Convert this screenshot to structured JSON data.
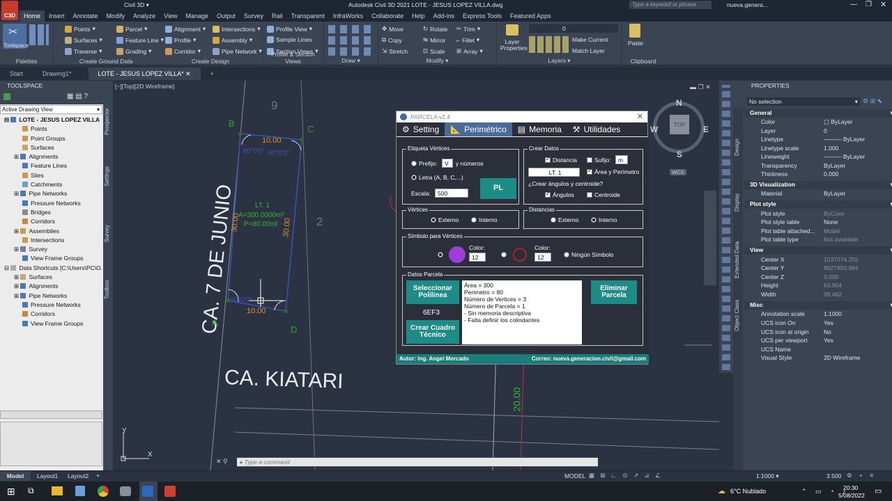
{
  "app": {
    "title": "Autodesk Civil 3D 2021  LOTE - JESUS LOPEZ VILLA.dwg",
    "workspace": "Civil 3D",
    "search_placeholder": "Type a keyword or phrase",
    "user": "nueva.genera...",
    "logo": "C3D"
  },
  "menu_tabs": [
    "Home",
    "Insert",
    "Annotate",
    "Modify",
    "Analyze",
    "View",
    "Manage",
    "Output",
    "Survey",
    "Rail",
    "Transparent",
    "InfraWorks",
    "Collaborate",
    "Help",
    "Add-ins",
    "Express Tools",
    "Featured Apps"
  ],
  "ribbon": {
    "toolspace": "Toolspace",
    "palettes": "Palettes",
    "ground": {
      "items": [
        "Points",
        "Surfaces",
        "Traverse",
        "Parcel",
        "Feature Line",
        "Grading"
      ],
      "title": "Create Ground Data"
    },
    "design": {
      "items": [
        "Alignment",
        "Profile",
        "Corridor",
        "Intersections",
        "Assembly",
        "Pipe Network"
      ],
      "title": "Create Design"
    },
    "profile": {
      "items": [
        "Profile View",
        "Sample Lines",
        "Section Views"
      ],
      "title": "Profile & Section Views"
    },
    "draw": {
      "title": "Draw"
    },
    "modify": {
      "items": [
        "Move",
        "Rotate",
        "Trim",
        "Copy",
        "Mirror",
        "Fillet",
        "Stretch",
        "Scale",
        "Array"
      ],
      "title": "Modify"
    },
    "layers": {
      "layer_properties": "Layer Properties",
      "layer_value": "0",
      "make_current": "Make Current",
      "match_layer": "Match Layer",
      "title": "Layers"
    },
    "clipboard": {
      "paste": "Paste",
      "title": "Clipboard"
    }
  },
  "doc_tabs": [
    "Start",
    "Drawing1*",
    "LOTE - JESUS LOPEZ VILLA*"
  ],
  "toolspace": {
    "title": "TOOLSPACE",
    "view": "Active Drawing View",
    "tree": [
      "LOTE - JESUS LOPEZ VILLA",
      "Points",
      "Point Groups",
      "Surfaces",
      "Alignments",
      "Feature Lines",
      "Sites",
      "Catchments",
      "Pipe Networks",
      "Pressure Networks",
      "Bridges",
      "Corridors",
      "Assemblies",
      "Intersections",
      "Survey",
      "View Frame Groups",
      "Data Shortcuts [C:\\Users\\PC\\O...",
      "Surfaces",
      "Alignments",
      "Pipe Networks",
      "Pressure Networks",
      "Corridors",
      "View Frame Groups"
    ],
    "side_tabs": [
      "Prospector",
      "Settings",
      "Survey",
      "Toolbox"
    ]
  },
  "viewport": {
    "label": "[−][Top][2D Wireframe]",
    "street1": "CA. 7 DE JUNIO",
    "street2": "CA. KIATARI",
    "lot_num": "9",
    "lot_num2": "2",
    "pts": [
      "A",
      "B",
      "C",
      "D"
    ],
    "dims": [
      "10.00",
      "10.00",
      "30.00",
      "30.00",
      "20.00"
    ],
    "angle": "90°0'0\"",
    "lot_label": "LT. 1",
    "area": "A=300.0000m²",
    "perim": "P=80.00ml",
    "compass": {
      "n": "N",
      "s": "S",
      "e": "E",
      "w": "W",
      "top": "TOP",
      "wcs": "WCS"
    },
    "command_placeholder": "Type a command"
  },
  "dialog": {
    "title": "PARCELA v2.4",
    "tabs": [
      "Setting",
      "Perimétrico",
      "Memoria",
      "Utilidades"
    ],
    "etiqueta": {
      "title": "Etiqueta Vértices",
      "prefijo": "Prefijo:",
      "prefijo_val": "V",
      "y_numeros": "y números",
      "letra": "Letra (A, B, C,...)",
      "escala": "Escala:",
      "escala_val": "500",
      "pl": "PL"
    },
    "crear": {
      "title": "Crear Datos",
      "distancia": "Distancia",
      "sufijo": "Sufijo:",
      "sufijo_val": "m",
      "lt_val": "LT. 1",
      "area_perim": "Área y Perímetro",
      "question": "¿Crear ángulos y centroide?",
      "angulos": "Ángulos",
      "centroide": "Centroide"
    },
    "vertices": {
      "title": "Vértices",
      "externo": "Externo",
      "interno": "Interno"
    },
    "distancias": {
      "title": "Distancias",
      "externo": "Externo",
      "interno": "Interno"
    },
    "simbolo": {
      "title": "Símbolo para Vértices",
      "color": "Color:",
      "color1": "12",
      "color2": "12",
      "ninguno": "Ningún Símbolo"
    },
    "datos": {
      "title": "Datos Parcela",
      "sel": "Seleccionar Polilinea",
      "handle": "6EF3",
      "crear_cuadro": "Crear Cuadro Técnico",
      "eliminar": "Eliminar Parcela",
      "info": [
        "Área = 300",
        "Perimetro = 80",
        "Número de Vertices = 3",
        "Número de Parcela = 1",
        "- Sin memoria descriptiva",
        "- Falta definir los colindantes"
      ]
    },
    "footer_left": "Autor: Ing. Angel Mercado",
    "footer_right": "Correo: nueva.generacion.civil@gmail.com"
  },
  "properties": {
    "title": "PROPERTIES",
    "selection": "No selection",
    "general": {
      "title": "General",
      "rows": [
        [
          "Color",
          "ByLayer"
        ],
        [
          "Layer",
          "0"
        ],
        [
          "Linetype",
          "ByLayer"
        ],
        [
          "Linetype scale",
          "1.000"
        ],
        [
          "Lineweight",
          "ByLayer"
        ],
        [
          "Transparency",
          "ByLayer"
        ],
        [
          "Thickness",
          "0.000"
        ]
      ]
    },
    "vis3d": {
      "title": "3D Visualization",
      "rows": [
        [
          "Material",
          "ByLayer"
        ]
      ]
    },
    "plot": {
      "title": "Plot style",
      "rows": [
        [
          "Plot style",
          "ByColor"
        ],
        [
          "Plot style table",
          "None"
        ],
        [
          "Plot table attached...",
          "Model"
        ],
        [
          "Plot table type",
          "Not available"
        ]
      ]
    },
    "view": {
      "title": "View",
      "rows": [
        [
          "Center X",
          "1537074.255"
        ],
        [
          "Center Y",
          "8927450.984"
        ],
        [
          "Center Z",
          "0.000"
        ],
        [
          "Height",
          "63.904"
        ],
        [
          "Width",
          "99.482"
        ]
      ]
    },
    "misc": {
      "title": "Misc",
      "rows": [
        [
          "Annotation scale",
          "1:1000"
        ],
        [
          "UCS icon On",
          "Yes"
        ],
        [
          "UCS icon at origin",
          "No"
        ],
        [
          "UCS per viewport",
          "Yes"
        ],
        [
          "UCS Name",
          ""
        ],
        [
          "Visual Style",
          "2D Wireframe"
        ]
      ]
    },
    "side_tabs": [
      "Design",
      "Display",
      "Extended Data",
      "Object Class"
    ]
  },
  "status": {
    "layouts": [
      "Model",
      "Layout1",
      "Layout2"
    ],
    "model": "MODEL",
    "scale": "1:1000",
    "zoom": "3.500"
  },
  "taskbar": {
    "weather": "6°C  Nublado",
    "time": "20:30",
    "date": "5/08/2022"
  }
}
